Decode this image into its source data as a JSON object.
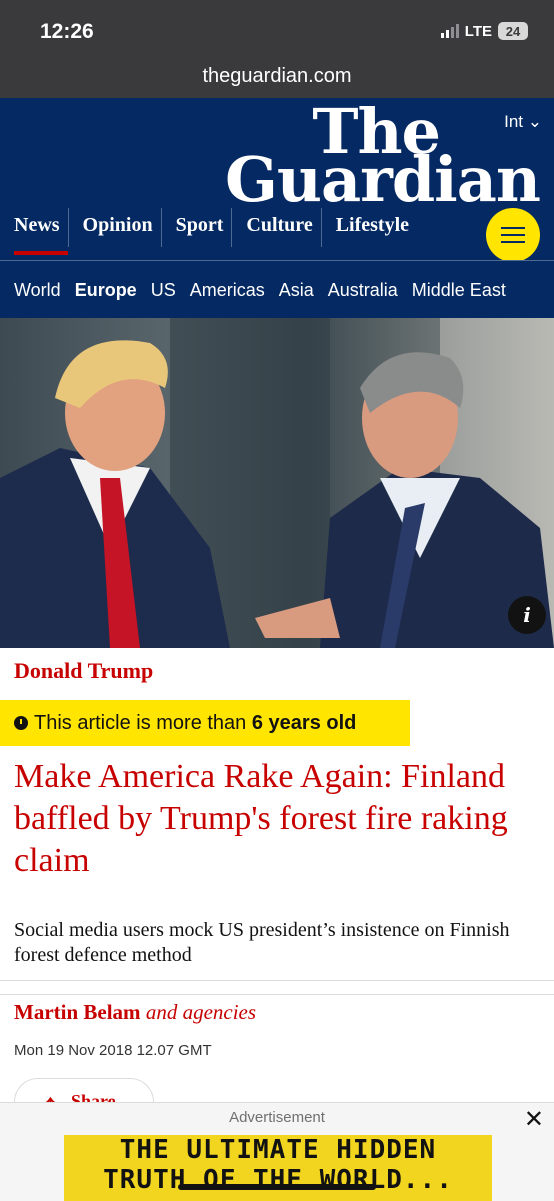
{
  "status": {
    "time": "12:26",
    "network": "LTE",
    "battery": "24"
  },
  "browser": {
    "url": "theguardian.com"
  },
  "header": {
    "logo_line1": "The",
    "logo_line2": "Guardian",
    "edition": "Int",
    "pillars": [
      "News",
      "Opinion",
      "Sport",
      "Culture",
      "Lifestyle"
    ],
    "active_pillar": "News"
  },
  "subnav": {
    "items": [
      "World",
      "Europe",
      "US",
      "Americas",
      "Asia",
      "Australia",
      "Middle East"
    ],
    "active": "Europe"
  },
  "hero": {
    "info_label": "i"
  },
  "article": {
    "tag": "Donald Trump",
    "age_notice_prefix": "This article is more than",
    "age_notice_value": "6 years old",
    "headline": "Make America Rake Again: Finland baffled by Trump's forest fire raking claim",
    "standfirst": "Social media users mock US president’s insistence on Finnish forest defence method",
    "byline_name": "Martin Belam",
    "byline_extra": "and agencies",
    "date": "Mon 19 Nov 2018 12.07 GMT",
    "share_label": "Share"
  },
  "ad": {
    "label": "Advertisement",
    "close": "✕",
    "line1": "THE ULTIMATE HIDDEN",
    "line2": "TRUTH OF THE WORLD..."
  },
  "colors": {
    "guardian_blue": "#052962",
    "news_red": "#c70000",
    "yellow": "#ffe500"
  }
}
